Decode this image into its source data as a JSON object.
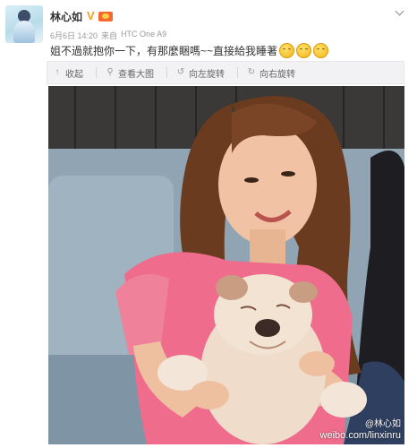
{
  "post": {
    "user_name": "林心如",
    "date": "6月6日 14:20",
    "source_prefix": "来自",
    "source_device": "HTC One A9",
    "text": "姐不過就抱你一下，有那麼睏嗎~~直接給我睡著",
    "emoji_count": 3
  },
  "toolbar": {
    "collapse_label": "收起",
    "view_large_label": "查看大图",
    "rotate_left_label": "向左旋转",
    "rotate_right_label": "向右旋转"
  },
  "photo": {
    "watermark_handle": "@林心如",
    "watermark_url": "weibo.com/linxinru"
  },
  "icons": {
    "verified": "v-badge-icon",
    "member": "member-crown-icon",
    "menu": "chevron-down-icon"
  },
  "colors": {
    "accent": "#f0a020",
    "toolbar_bg": "#f2f2f5",
    "shirt": "#f06c8c"
  }
}
